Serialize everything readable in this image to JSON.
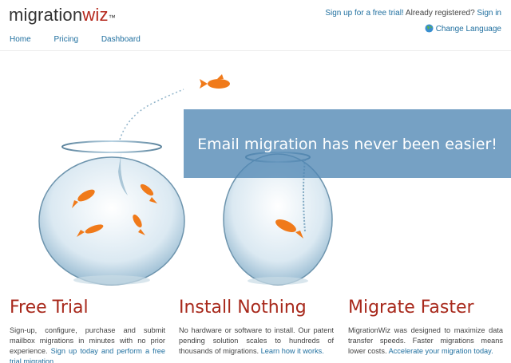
{
  "logo": {
    "part1": "migration",
    "part2": "wiz",
    "tm": "™"
  },
  "nav": {
    "items": [
      "Home",
      "Pricing",
      "Dashboard"
    ]
  },
  "account": {
    "signup_link": "Sign up for a free trial!",
    "registered_text": " Already registered? ",
    "signin_link": "Sign in"
  },
  "language": {
    "label": "Change Language"
  },
  "hero": {
    "banner_text": "Email migration has never been easier!"
  },
  "features": [
    {
      "title": "Free Trial",
      "text": "Sign-up, configure, purchase and submit mailbox migrations in minutes with no prior experience. ",
      "link": "Sign up today and perform a free trial migration."
    },
    {
      "title": "Install Nothing",
      "text": "No hardware or software to install. Our patent pending solution scales to hundreds of thousands of migrations. ",
      "link": "Learn how it works."
    },
    {
      "title": "Migrate Faster",
      "text": "MigrationWiz was designed to maximize data transfer speeds. Faster migrations means lower costs. ",
      "link": "Accelerate your migration today."
    }
  ],
  "colors": {
    "brand_red": "#a8291c",
    "link_blue": "#1f6f9f",
    "banner_blue": "#5087b4",
    "fish_orange": "#f07a1a"
  }
}
